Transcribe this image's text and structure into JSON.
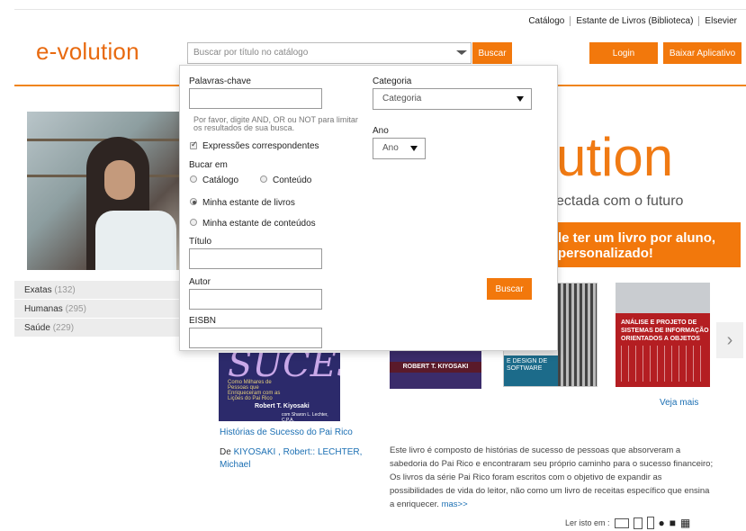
{
  "header": {
    "top_links": [
      "Catálogo",
      "Estante de Livros (Biblioteca)",
      "Elsevier"
    ],
    "logo": "e-volution",
    "search_placeholder": "Buscar por título no catálogo",
    "search_button": "Buscar",
    "login_button": "Login",
    "download_app_button": "Baixar Aplicativo"
  },
  "hero": {
    "big_text": "ution",
    "subtitle": "ectada com o futuro",
    "band_line1": "le ter um livro por aluno,",
    "band_line2": "personalizado!"
  },
  "categories": [
    {
      "label": "Exatas",
      "count": "(132)"
    },
    {
      "label": "Humanas",
      "count": "(295)"
    },
    {
      "label": "Saúde",
      "count": "(229)"
    }
  ],
  "advanced_search": {
    "keywords_label": "Palavras-chave",
    "keywords_value": "",
    "hint": "Por favor, digite AND, OR ou NOT para limitar os resultados de sua busca.",
    "matching_label": "Expressões correspondentes",
    "matching_checked": true,
    "search_in_label": "Bucar em",
    "option_catalog": "Catálogo",
    "option_content": "Conteúdo",
    "option_my_books": "Minha estante de livros",
    "option_my_content": "Minha estante de conteúdos",
    "title_label": "Título",
    "author_label": "Autor",
    "eisbn_label": "EISBN",
    "category_label": "Categoria",
    "category_value": "Categoria",
    "year_label": "Ano",
    "year_value": "Ano",
    "search_button": "Buscar"
  },
  "featured_book": {
    "title": "Histórias de Sucesso do Pai Rico",
    "author_prefix": "De",
    "authors": "KIYOSAKI , Robert:: LECHTER, Michael",
    "description": "Este livro é composto de histórias de sucesso de pessoas que absorveram a sabedoria do Pai Rico e encontraram seu próprio caminho para o sucesso financeiro; Os livros da série Pai Rico foram escritos com o objetivo de expandir as possibilidades de vida do leitor, não como um livro de receitas específico que ensina a enriquecer.",
    "more_link": "mas>>",
    "cover_title": "SUCESSO",
    "cover_text": "Como Milhares de Pessoas que Enriqueceram com as Lições do Pai Rico",
    "cover_author": "Robert T. Kiyosaki",
    "cover_coauthor": "com Sharon L. Lechter, C.P.A."
  },
  "carousel": {
    "book2_author": "ROBERT T. KIYOSAKI",
    "book3_band": "E DESIGN DE SOFTWARE",
    "book4_title": "ANÁLISE E PROJETO DE SISTEMAS DE INFORMAÇÃO ORIENTADOS A OBJETOS",
    "see_more": "Veja mais",
    "next_arrow": "›"
  },
  "read_on": {
    "label": "Ler isto em :"
  },
  "colors": {
    "brand_orange": "#f2780c",
    "link_blue": "#1b6fb3"
  }
}
